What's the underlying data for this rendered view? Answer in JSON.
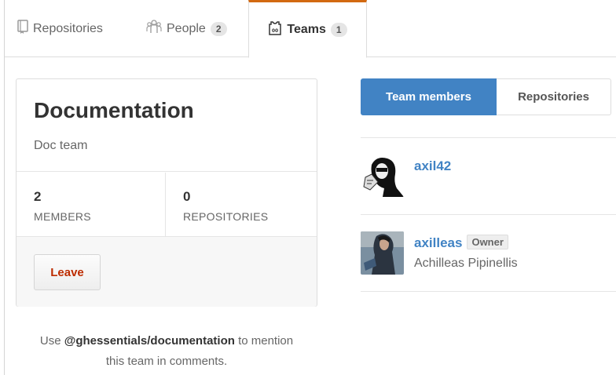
{
  "tabs": [
    {
      "label": "Repositories",
      "icon": "repo-icon"
    },
    {
      "label": "People",
      "count": "2",
      "icon": "people-icon"
    },
    {
      "label": "Teams",
      "count": "1",
      "icon": "jersey-icon"
    }
  ],
  "active_tab_color": "#d26911",
  "team": {
    "name": "Documentation",
    "description": "Doc team",
    "members_count": "2",
    "members_label": "MEMBERS",
    "repos_count": "0",
    "repos_label": "REPOSITORIES",
    "leave_label": "Leave"
  },
  "mention": {
    "prefix": "Use",
    "handle": "@ghessentials/documentation",
    "suffix": "to mention",
    "line2": "this team in comments."
  },
  "toggle": {
    "members_label": "Team members",
    "repos_label": "Repositories",
    "accent": "#4183c4"
  },
  "members": [
    {
      "username": "axil42",
      "fullname": "",
      "role": ""
    },
    {
      "username": "axilleas",
      "fullname": "Achilleas Pipinellis",
      "role": "Owner"
    }
  ]
}
